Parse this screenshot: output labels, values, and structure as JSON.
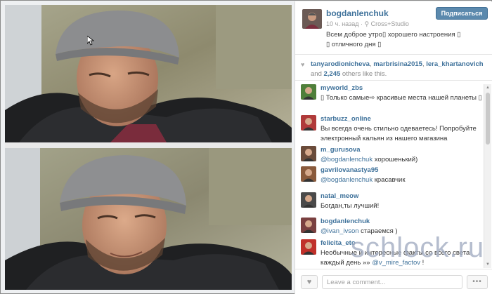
{
  "post": {
    "owner_username": "bogdanlenchuk",
    "follow_label": "Подписаться",
    "time_ago": "10 ч. назад",
    "location": "Cross+Studio",
    "caption_line1": "Всем доброе утро▯ хорошего настроения ▯",
    "caption_line2": "▯ отличного дня ▯"
  },
  "likes": {
    "users": [
      "tanyarodionicheva",
      "marbrisina2015",
      "lera_khartanovich"
    ],
    "and_text": "and",
    "count": "2,245",
    "others_text": "others like this."
  },
  "comments": [
    {
      "user": "myworld_zbs",
      "parts": [
        {
          "text": "▯ Только самые⇨ красивые места нашей планеты ▯",
          "mention": false
        }
      ],
      "avatar_color": "#4f7f3a"
    },
    {
      "user": "starbuzz_online",
      "parts": [
        {
          "text": "Вы всегда очень стильно одеваетесь! Попробуйте электронный кальян из нашего магазина",
          "mention": false
        }
      ],
      "avatar_color": "#b03a3a"
    },
    {
      "user": "m_gurusova",
      "parts": [
        {
          "text": "@bogdanlenchuk",
          "mention": true
        },
        {
          "text": " хорошенький)",
          "mention": false
        }
      ],
      "avatar_color": "#6a4b3a"
    },
    {
      "user": "gavrilovanastya95",
      "parts": [
        {
          "text": "@bogdanlenchuk",
          "mention": true
        },
        {
          "text": " красавчик",
          "mention": false
        }
      ],
      "avatar_color": "#8a5a3c"
    },
    {
      "user": "natal_meow",
      "parts": [
        {
          "text": "Богдан,ты лучший!",
          "mention": false
        }
      ],
      "avatar_color": "#4a4a4a"
    },
    {
      "user": "bogdanlenchuk",
      "parts": [
        {
          "text": "@ivan_ivson",
          "mention": true
        },
        {
          "text": " стараемся )",
          "mention": false
        }
      ],
      "avatar_color": "#7a4040"
    },
    {
      "user": "felicita_eto",
      "parts": [
        {
          "text": "Необычные и интересные факты со всего света каждый день »» ",
          "mention": false
        },
        {
          "text": "@v_mire_factov",
          "mention": true
        },
        {
          "text": " !",
          "mention": false
        }
      ],
      "avatar_color": "#c0302a"
    }
  ],
  "comment_box": {
    "placeholder": "Leave a comment...",
    "more_label": "•••"
  },
  "icons": {
    "like": "heart-icon",
    "location": "map-pin-icon",
    "more": "ellipsis-icon",
    "scroll_up": "scroll-up-arrow-icon",
    "scroll_down": "scroll-down-arrow-icon"
  },
  "watermark": "schlock.ru"
}
